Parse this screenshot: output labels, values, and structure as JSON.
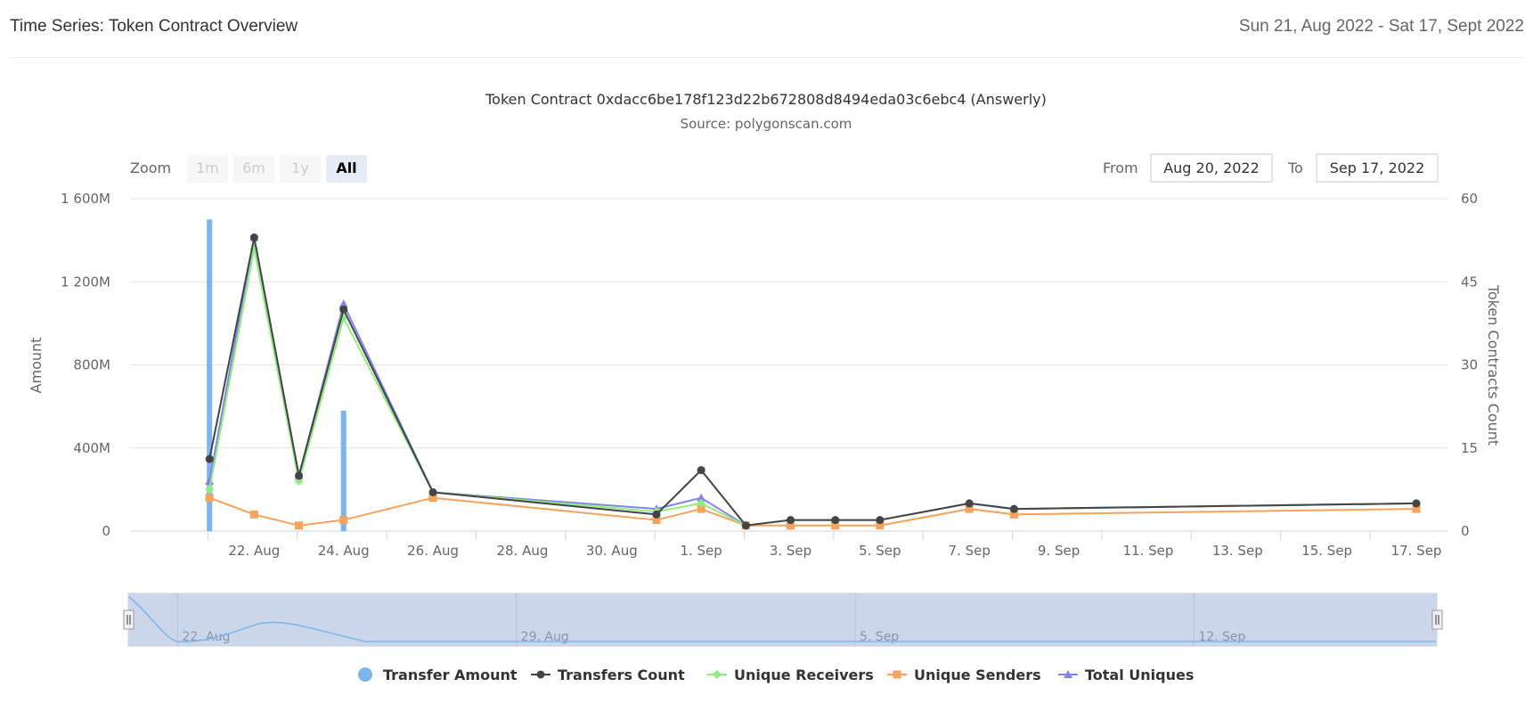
{
  "header": {
    "title": "Time Series: Token Contract Overview",
    "date_range": "Sun 21, Aug 2022 - Sat 17, Sept 2022"
  },
  "range_selector": {
    "zoom_label": "Zoom",
    "buttons": [
      "1m",
      "6m",
      "1y",
      "All"
    ],
    "active": "All",
    "from_label": "From",
    "from_value": "Aug 20, 2022",
    "to_label": "To",
    "to_value": "Sep 17, 2022"
  },
  "navigator": {
    "labels": [
      "22. Aug",
      "29. Aug",
      "5. Sep",
      "12. Sep"
    ]
  },
  "chart_data": {
    "type": "line",
    "title": "Token Contract 0xdacc6be178f123d22b672808d8494eda03c6ebc4 (Answerly)",
    "subtitle": "Source: polygonscan.com",
    "x_tick_labels": [
      "22. Aug",
      "24. Aug",
      "26. Aug",
      "28. Aug",
      "30. Aug",
      "1. Sep",
      "3. Sep",
      "5. Sep",
      "7. Sep",
      "9. Sep",
      "11. Sep",
      "13. Sep",
      "15. Sep",
      "17. Sep"
    ],
    "x_range": [
      "2022-08-20",
      "2022-09-17"
    ],
    "y_left": {
      "label": "Amount",
      "range": [
        0,
        1600000000
      ],
      "tick_labels": [
        "0",
        "400M",
        "800M",
        "1 200M",
        "1 600M"
      ]
    },
    "y_right": {
      "label": "Token Contracts Count",
      "range": [
        0,
        60
      ],
      "tick_labels": [
        "0",
        "15",
        "30",
        "45",
        "60"
      ]
    },
    "grid": true,
    "legend_position": "bottom",
    "series": [
      {
        "name": "Transfer Amount",
        "type": "column",
        "axis": "left",
        "color": "#7cb5ec",
        "marker": "circle",
        "points": [
          [
            "2022-08-21",
            1500000000
          ],
          [
            "2022-08-24",
            580000000
          ]
        ]
      },
      {
        "name": "Transfers Count",
        "type": "line",
        "axis": "right",
        "color": "#434348",
        "marker": "circle",
        "points": [
          [
            "2022-08-21",
            13
          ],
          [
            "2022-08-22",
            53
          ],
          [
            "2022-08-23",
            10
          ],
          [
            "2022-08-24",
            40
          ],
          [
            "2022-08-26",
            7
          ],
          [
            "2022-08-31",
            3
          ],
          [
            "2022-09-01",
            11
          ],
          [
            "2022-09-02",
            1
          ],
          [
            "2022-09-03",
            2
          ],
          [
            "2022-09-04",
            2
          ],
          [
            "2022-09-05",
            2
          ],
          [
            "2022-09-07",
            5
          ],
          [
            "2022-09-08",
            4
          ],
          [
            "2022-09-17",
            5
          ]
        ]
      },
      {
        "name": "Unique Receivers",
        "type": "line",
        "axis": "right",
        "color": "#90ed7d",
        "marker": "diamond",
        "points": [
          [
            "2022-08-21",
            7.5
          ],
          [
            "2022-08-22",
            51
          ],
          [
            "2022-08-23",
            9
          ],
          [
            "2022-08-24",
            38.5
          ],
          [
            "2022-08-26",
            7
          ],
          [
            "2022-08-31",
            3.5
          ],
          [
            "2022-09-01",
            5
          ],
          [
            "2022-09-02",
            1
          ],
          [
            "2022-09-03",
            2
          ],
          [
            "2022-09-04",
            2
          ],
          [
            "2022-09-05",
            2
          ],
          [
            "2022-09-07",
            5
          ],
          [
            "2022-09-08",
            4
          ],
          [
            "2022-09-17",
            5
          ]
        ]
      },
      {
        "name": "Unique Senders",
        "type": "line",
        "axis": "right",
        "color": "#f7a35c",
        "marker": "square",
        "points": [
          [
            "2022-08-21",
            6
          ],
          [
            "2022-08-22",
            3
          ],
          [
            "2022-08-23",
            1
          ],
          [
            "2022-08-24",
            2
          ],
          [
            "2022-08-26",
            6
          ],
          [
            "2022-08-31",
            2
          ],
          [
            "2022-09-01",
            4
          ],
          [
            "2022-09-02",
            1
          ],
          [
            "2022-09-03",
            1
          ],
          [
            "2022-09-04",
            1
          ],
          [
            "2022-09-05",
            1
          ],
          [
            "2022-09-07",
            4
          ],
          [
            "2022-09-08",
            3
          ],
          [
            "2022-09-17",
            4
          ]
        ]
      },
      {
        "name": "Total Uniques",
        "type": "line",
        "axis": "right",
        "color": "#8085e9",
        "marker": "triangle",
        "points": [
          [
            "2022-08-21",
            9
          ],
          [
            "2022-08-22",
            53
          ],
          [
            "2022-08-23",
            10
          ],
          [
            "2022-08-24",
            41
          ],
          [
            "2022-08-26",
            7
          ],
          [
            "2022-08-31",
            4
          ],
          [
            "2022-09-01",
            6
          ],
          [
            "2022-09-02",
            1
          ],
          [
            "2022-09-03",
            2
          ],
          [
            "2022-09-04",
            2
          ],
          [
            "2022-09-05",
            2
          ],
          [
            "2022-09-07",
            5
          ],
          [
            "2022-09-08",
            4
          ],
          [
            "2022-09-17",
            5
          ]
        ]
      }
    ]
  }
}
